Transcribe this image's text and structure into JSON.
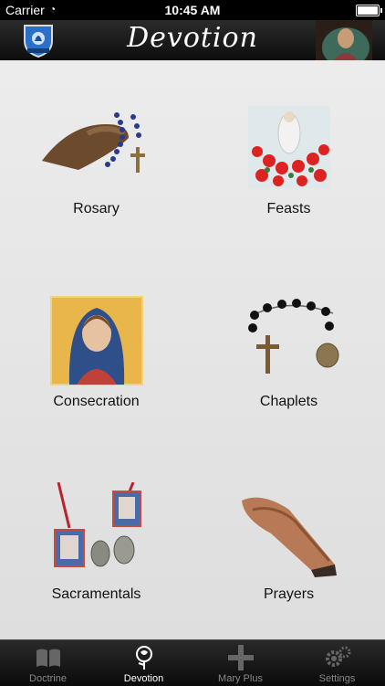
{
  "status": {
    "carrier": "Carrier",
    "time": "10:45 AM"
  },
  "navbar": {
    "title": "Devotion"
  },
  "tiles": [
    {
      "label": "Rosary"
    },
    {
      "label": "Feasts"
    },
    {
      "label": "Consecration"
    },
    {
      "label": "Chaplets"
    },
    {
      "label": "Sacramentals"
    },
    {
      "label": "Prayers"
    }
  ],
  "tabs": [
    {
      "label": "Doctrine",
      "icon": "book-icon"
    },
    {
      "label": "Devotion",
      "icon": "rose-icon"
    },
    {
      "label": "Mary Plus",
      "icon": "plus-icon"
    },
    {
      "label": "Settings",
      "icon": "gears-icon"
    }
  ],
  "colors": {
    "navbar": "#1a1a1a",
    "background": "#e6e6e6",
    "active_tab": "#ffffff",
    "inactive_tab": "#888888"
  }
}
